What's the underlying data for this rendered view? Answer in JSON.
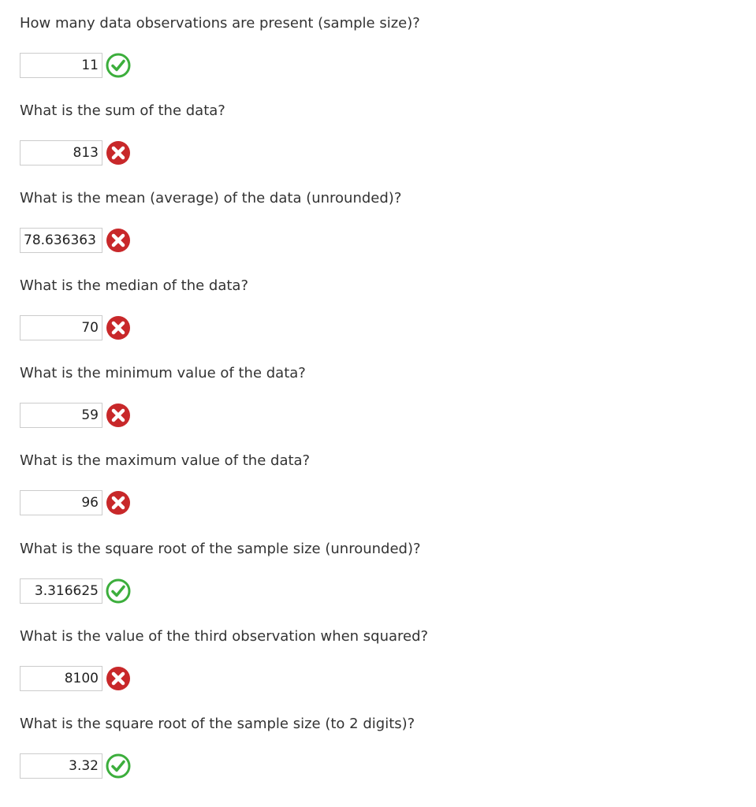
{
  "questions": [
    {
      "text": "How many data observations are present (sample size)?",
      "answer": "11",
      "status": "correct",
      "icon": "check-icon"
    },
    {
      "text": "What is the sum of the data?",
      "answer": "813",
      "status": "incorrect",
      "icon": "x-icon"
    },
    {
      "text": "What is the mean (average) of the data (unrounded)?",
      "answer": "78.636363",
      "status": "incorrect",
      "icon": "x-icon"
    },
    {
      "text": "What is the median of the data?",
      "answer": "70",
      "status": "incorrect",
      "icon": "x-icon"
    },
    {
      "text": "What is the minimum value of the data?",
      "answer": "59",
      "status": "incorrect",
      "icon": "x-icon"
    },
    {
      "text": "What is the maximum value of the data?",
      "answer": "96",
      "status": "incorrect",
      "icon": "x-icon"
    },
    {
      "text": "What is the square root of the sample size (unrounded)?",
      "answer": "3.316625",
      "status": "correct",
      "icon": "check-icon"
    },
    {
      "text": "What is the value of the third observation when squared?",
      "answer": "8100",
      "status": "incorrect",
      "icon": "x-icon"
    },
    {
      "text": "What is the square root of the sample size (to 2 digits)?",
      "answer": "3.32",
      "status": "correct",
      "icon": "check-icon"
    }
  ],
  "colors": {
    "correct": "#3cae3c",
    "incorrect": "#c8282a"
  }
}
